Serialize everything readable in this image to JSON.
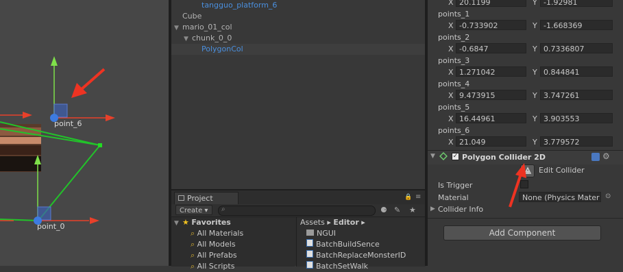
{
  "scene": {
    "point_labels": [
      "point_6",
      "point_0"
    ]
  },
  "hierarchy": {
    "rows": [
      {
        "label": "tangguo_platform_6",
        "indent": 3,
        "selected": false,
        "blue": true,
        "arrow": ""
      },
      {
        "label": "Cube",
        "indent": 1,
        "selected": false,
        "blue": false,
        "arrow": ""
      },
      {
        "label": "mario_01_col",
        "indent": 0,
        "selected": false,
        "blue": false,
        "arrow": "▼"
      },
      {
        "label": "chunk_0_0",
        "indent": 1,
        "selected": false,
        "blue": false,
        "arrow": "▼"
      },
      {
        "label": "PolygonCol",
        "indent": 3,
        "selected": true,
        "blue": true,
        "arrow": ""
      }
    ]
  },
  "project": {
    "tab_label": "Project",
    "create_label": "Create ▾",
    "favorites_label": "Favorites",
    "favorites": [
      "All Materials",
      "All Models",
      "All Prefabs",
      "All Scripts"
    ],
    "breadcrumb": {
      "root": "Assets",
      "sep": "▸",
      "folder": "Editor"
    },
    "files": [
      {
        "name": "NGUI",
        "icon": "folder-icon"
      },
      {
        "name": "BatchBuildSence",
        "icon": "script-icon"
      },
      {
        "name": "BatchReplaceMonsterID",
        "icon": "script-icon"
      },
      {
        "name": "BatchSetWalk",
        "icon": "script-icon"
      }
    ]
  },
  "inspector": {
    "first_point": {
      "x": "20.1199",
      "y": "-1.92981"
    },
    "points": [
      {
        "name": "points_1",
        "x": "-0.733902",
        "y": "-1.668369"
      },
      {
        "name": "points_2",
        "x": "-0.6847",
        "y": "0.7336807"
      },
      {
        "name": "points_3",
        "x": "1.271042",
        "y": "0.844841"
      },
      {
        "name": "points_4",
        "x": "9.473915",
        "y": "3.747261"
      },
      {
        "name": "points_5",
        "x": "16.44961",
        "y": "3.903553"
      },
      {
        "name": "points_6",
        "x": "21.049",
        "y": "3.779572"
      }
    ],
    "x_label": "X",
    "y_label": "Y",
    "component_title": "Polygon Collider 2D",
    "edit_collider_label": "Edit Collider",
    "is_trigger_label": "Is Trigger",
    "material_label": "Material",
    "material_value": "None (Physics Mater",
    "collider_info_label": "Collider Info",
    "add_component_label": "Add Component"
  },
  "colors": {
    "accent_blue": "#4a8fde",
    "arrow_red": "#e8402a",
    "gizmo_green": "#7fe04a",
    "collider_green": "#22c32a",
    "handle_blue": "#3d7be0"
  }
}
